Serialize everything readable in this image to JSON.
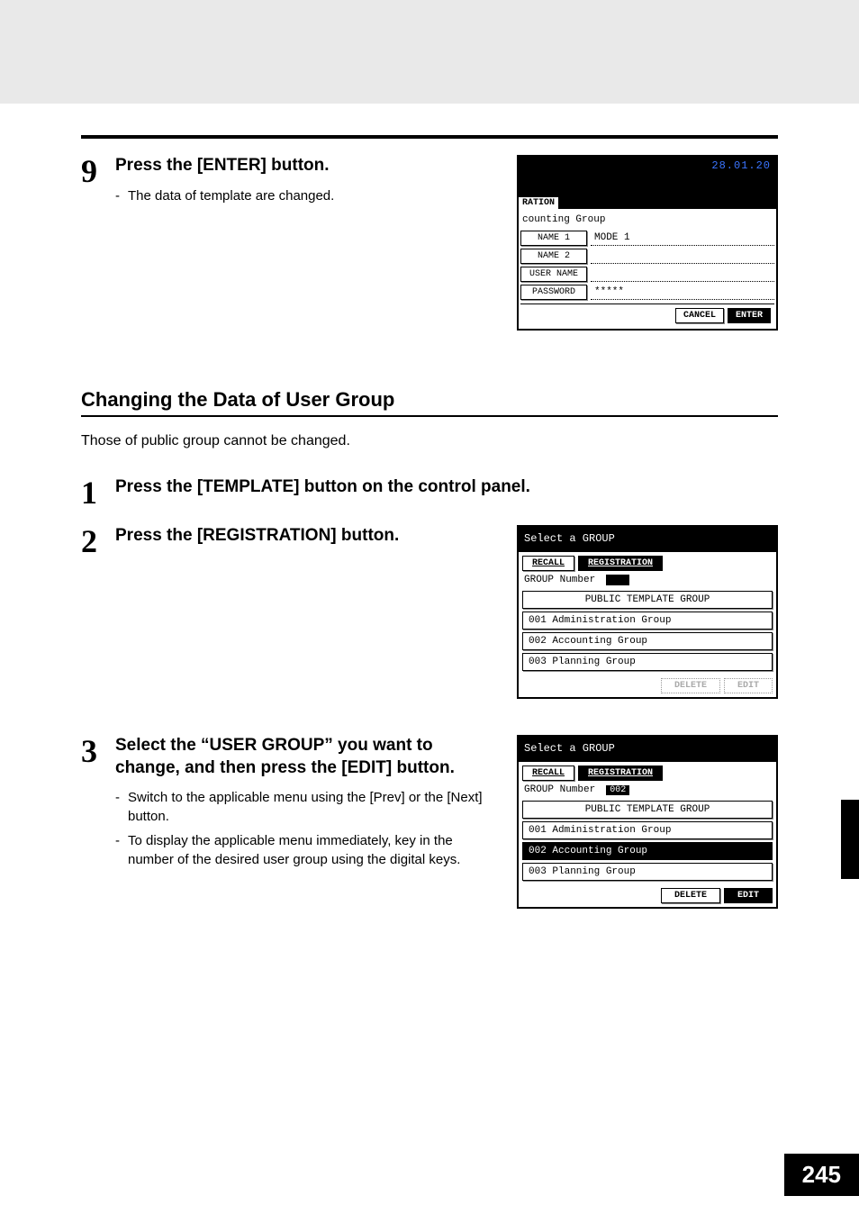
{
  "step9": {
    "num": "9",
    "head": "Press the [ENTER] button.",
    "note": "The data of template are changed."
  },
  "ss1": {
    "date": "28.01.20",
    "tab": "RATION",
    "context": "counting Group",
    "rows": {
      "name1_label": "NAME 1",
      "name1_value": "MODE 1",
      "name2_label": "NAME 2",
      "name2_value": "",
      "username_label": "USER NAME",
      "username_value": "",
      "password_label": "PASSWORD",
      "password_value": "*****"
    },
    "cancel": "CANCEL",
    "enter": "ENTER"
  },
  "section": {
    "head": "Changing the Data of User Group",
    "desc": "Those of public group cannot be changed."
  },
  "step1": {
    "num": "1",
    "head": "Press the [TEMPLATE] button on the control panel."
  },
  "step2": {
    "num": "2",
    "head": "Press the [REGISTRATION] button."
  },
  "ss2": {
    "title": "Select a GROUP",
    "tab_recall": "RECALL",
    "tab_reg": "REGISTRATION",
    "group_number_label": "GROUP Number",
    "group_number_value": "",
    "items": {
      "i0": "PUBLIC TEMPLATE GROUP",
      "i1": "001 Administration Group",
      "i2": "002 Accounting Group",
      "i3": "003 Planning Group"
    },
    "delete": "DELETE",
    "edit": "EDIT"
  },
  "step3": {
    "num": "3",
    "head": "Select the “USER GROUP” you want to change, and then press the [EDIT] button.",
    "note1": "Switch to the applicable menu using the [Prev] or the [Next] button.",
    "note2": "To display the applicable menu immediately, key in the number of the desired user group using the digital keys."
  },
  "ss3": {
    "title": "Select a GROUP",
    "tab_recall": "RECALL",
    "tab_reg": "REGISTRATION",
    "group_number_label": "GROUP Number",
    "group_number_value": "002",
    "items": {
      "i0": "PUBLIC TEMPLATE GROUP",
      "i1": "001 Administration Group",
      "i2": "002 Accounting Group",
      "i3": "003 Planning Group"
    },
    "delete": "DELETE",
    "edit": "EDIT"
  },
  "page_number": "245"
}
